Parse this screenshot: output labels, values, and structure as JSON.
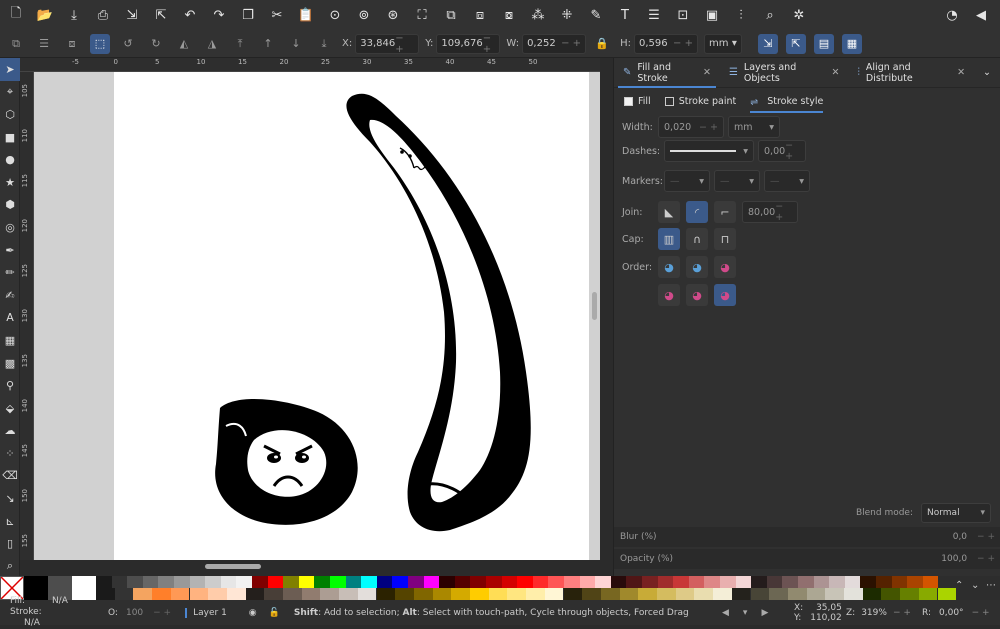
{
  "commands": [
    {
      "name": "new-document",
      "glyph": "🗋"
    },
    {
      "name": "open-file",
      "glyph": "📂"
    },
    {
      "name": "save-file",
      "glyph": "⤓"
    },
    {
      "name": "print",
      "glyph": "⎙"
    },
    {
      "name": "import",
      "glyph": "⇲"
    },
    {
      "name": "export",
      "glyph": "⇱"
    },
    {
      "name": "undo",
      "glyph": "↶"
    },
    {
      "name": "redo",
      "glyph": "↷"
    },
    {
      "name": "copy",
      "glyph": "❐"
    },
    {
      "name": "cut",
      "glyph": "✂"
    },
    {
      "name": "paste",
      "glyph": "📋"
    },
    {
      "name": "zoom-selection",
      "glyph": "⊙"
    },
    {
      "name": "zoom-drawing",
      "glyph": "⊚"
    },
    {
      "name": "zoom-page",
      "glyph": "⊛"
    },
    {
      "name": "zoom-fit",
      "glyph": "⛶"
    },
    {
      "name": "duplicate",
      "glyph": "⧉"
    },
    {
      "name": "clone",
      "glyph": "⧈"
    },
    {
      "name": "unlink-clone",
      "glyph": "⧇"
    },
    {
      "name": "group",
      "glyph": "⁂"
    },
    {
      "name": "ungroup",
      "glyph": "⁜"
    },
    {
      "name": "xml-editor",
      "glyph": "✎"
    },
    {
      "name": "text-font",
      "glyph": "T"
    },
    {
      "name": "layers",
      "glyph": "☰"
    },
    {
      "name": "object-properties",
      "glyph": "⊡"
    },
    {
      "name": "symbols",
      "glyph": "▣"
    },
    {
      "name": "align-distribute",
      "glyph": "⫶"
    },
    {
      "name": "find-replace",
      "glyph": "⌕"
    },
    {
      "name": "preferences",
      "glyph": "✲"
    }
  ],
  "right_commands": [
    {
      "name": "snap-toggle",
      "glyph": "◔"
    },
    {
      "name": "command-overflow",
      "glyph": "◀"
    }
  ],
  "controls": {
    "x_label": "X:",
    "x_value": "33,846",
    "y_label": "Y:",
    "y_value": "109,676",
    "w_label": "W:",
    "w_value": "0,252",
    "h_label": "H:",
    "h_value": "0,596",
    "unit": "mm"
  },
  "tools": [
    {
      "name": "selector",
      "glyph": "➤",
      "on": true
    },
    {
      "name": "node",
      "glyph": "⌖"
    },
    {
      "name": "shape-builder",
      "glyph": "⬡"
    },
    {
      "name": "rectangle",
      "glyph": "■"
    },
    {
      "name": "ellipse",
      "glyph": "●"
    },
    {
      "name": "star",
      "glyph": "★"
    },
    {
      "name": "box3d",
      "glyph": "⬢"
    },
    {
      "name": "spiral",
      "glyph": "◎"
    },
    {
      "name": "pen",
      "glyph": "✒"
    },
    {
      "name": "pencil",
      "glyph": "✏"
    },
    {
      "name": "calligraphy",
      "glyph": "✍"
    },
    {
      "name": "text",
      "glyph": "A"
    },
    {
      "name": "gradient",
      "glyph": "▦"
    },
    {
      "name": "mesh",
      "glyph": "▩"
    },
    {
      "name": "dropper",
      "glyph": "⚲"
    },
    {
      "name": "paint-bucket",
      "glyph": "⬙"
    },
    {
      "name": "tweak",
      "glyph": "☁"
    },
    {
      "name": "spray",
      "glyph": "⁘"
    },
    {
      "name": "eraser",
      "glyph": "⌫"
    },
    {
      "name": "connector",
      "glyph": "↘"
    },
    {
      "name": "measure",
      "glyph": "⊾"
    },
    {
      "name": "pages",
      "glyph": "▯"
    },
    {
      "name": "zoom",
      "glyph": "⌕"
    }
  ],
  "hruler_ticks": [
    "-5",
    "0",
    "5",
    "10",
    "15",
    "20",
    "25",
    "30",
    "35",
    "40",
    "45",
    "50"
  ],
  "vruler_ticks": [
    "105",
    "110",
    "115",
    "120",
    "125",
    "130",
    "135",
    "140",
    "145",
    "150",
    "155"
  ],
  "panel": {
    "tabs": [
      {
        "label": "Fill and Stroke",
        "icon": "✎",
        "on": true
      },
      {
        "label": "Layers and Objects",
        "icon": "☰",
        "on": false
      },
      {
        "label": "Align and Distribute",
        "icon": "⫶",
        "on": false
      }
    ],
    "subtabs": [
      {
        "label": "Fill",
        "on": false
      },
      {
        "label": "Stroke paint",
        "on": false
      },
      {
        "label": "Stroke style",
        "on": true
      }
    ],
    "width_label": "Width:",
    "width_value": "0,020",
    "width_unit": "mm",
    "dashes_label": "Dashes:",
    "dashes_offset": "0,00",
    "markers_label": "Markers:",
    "join_label": "Join:",
    "miter_value": "80,00",
    "cap_label": "Cap:",
    "order_label": "Order:",
    "blend_label": "Blend mode:",
    "blend_value": "Normal",
    "blur_label": "Blur (%)",
    "blur_value": "0,0",
    "opacity_label": "Opacity (%)",
    "opacity_value": "100,0"
  },
  "status": {
    "fill_label": "Fill:",
    "fill_value": "N/A",
    "stroke_label": "Stroke:",
    "stroke_value": "N/A",
    "opacity_label": "O:",
    "opacity_value": "100",
    "layer": "Layer 1",
    "message_bold1": "Shift",
    "message_text1": ": Add to selection; ",
    "message_bold2": "Alt",
    "message_text2": ": Select with touch-path, Cycle through objects, Forced Drag",
    "x_label": "X:",
    "x_value": "35,05",
    "y_label": "Y:",
    "y_value": "110,02",
    "zoom_label": "Z:",
    "zoom_value": "319%",
    "rot_label": "R:",
    "rot_value": "0,00°"
  },
  "palette_colors": [
    "#000000",
    "#4d4d4d",
    "#ffffff",
    "#1a1a1a",
    "#333333",
    "#4d4d4d",
    "#666666",
    "#808080",
    "#999999",
    "#b3b3b3",
    "#cccccc",
    "#e6e6e6",
    "#f2f2f2",
    "#800000",
    "#ff0000",
    "#808000",
    "#ffff00",
    "#008000",
    "#00ff00",
    "#008080",
    "#00ffff",
    "#000080",
    "#0000ff",
    "#800080",
    "#ff00ff",
    "#2b0000",
    "#550000",
    "#800000",
    "#aa0000",
    "#d40000",
    "#ff0000",
    "#ff2a2a",
    "#ff5555",
    "#ff8080",
    "#ffaaaa",
    "#ffd5d5",
    "#280b0b",
    "#501616",
    "#782121",
    "#a02c2c",
    "#c83737",
    "#d35f5f",
    "#de8787",
    "#e9afaf",
    "#f4d7d7",
    "#241c1c",
    "#483737",
    "#6c5353",
    "#916f6f",
    "#ac9393",
    "#c8b7b7",
    "#e3dbdb",
    "#2b1100",
    "#552200",
    "#803300",
    "#aa4400",
    "#d45500"
  ],
  "palette_colors2": [
    "#1a1a1a",
    "#333333",
    "#f4a460",
    "#ff7f2a",
    "#ff9955",
    "#ffb380",
    "#ffccaa",
    "#ffe6d5",
    "#241f1c",
    "#483e37",
    "#6c5d53",
    "#917c6f",
    "#ac9d93",
    "#c8beb7",
    "#e3dedb",
    "#2b2200",
    "#554400",
    "#806600",
    "#aa8800",
    "#d4aa00",
    "#ffcc00",
    "#ffdd55",
    "#ffe680",
    "#ffeeaa",
    "#fff6d5",
    "#28220b",
    "#504416",
    "#786721",
    "#a0892c",
    "#c8ab37",
    "#d4bc5f",
    "#deca87",
    "#e9ddaf",
    "#f4eed7",
    "#24221c",
    "#484537",
    "#6c6753",
    "#918a6f",
    "#aca793",
    "#c8c4b7",
    "#e3e2db",
    "#1c2b00",
    "#445500",
    "#668000",
    "#88aa00",
    "#aad400"
  ]
}
